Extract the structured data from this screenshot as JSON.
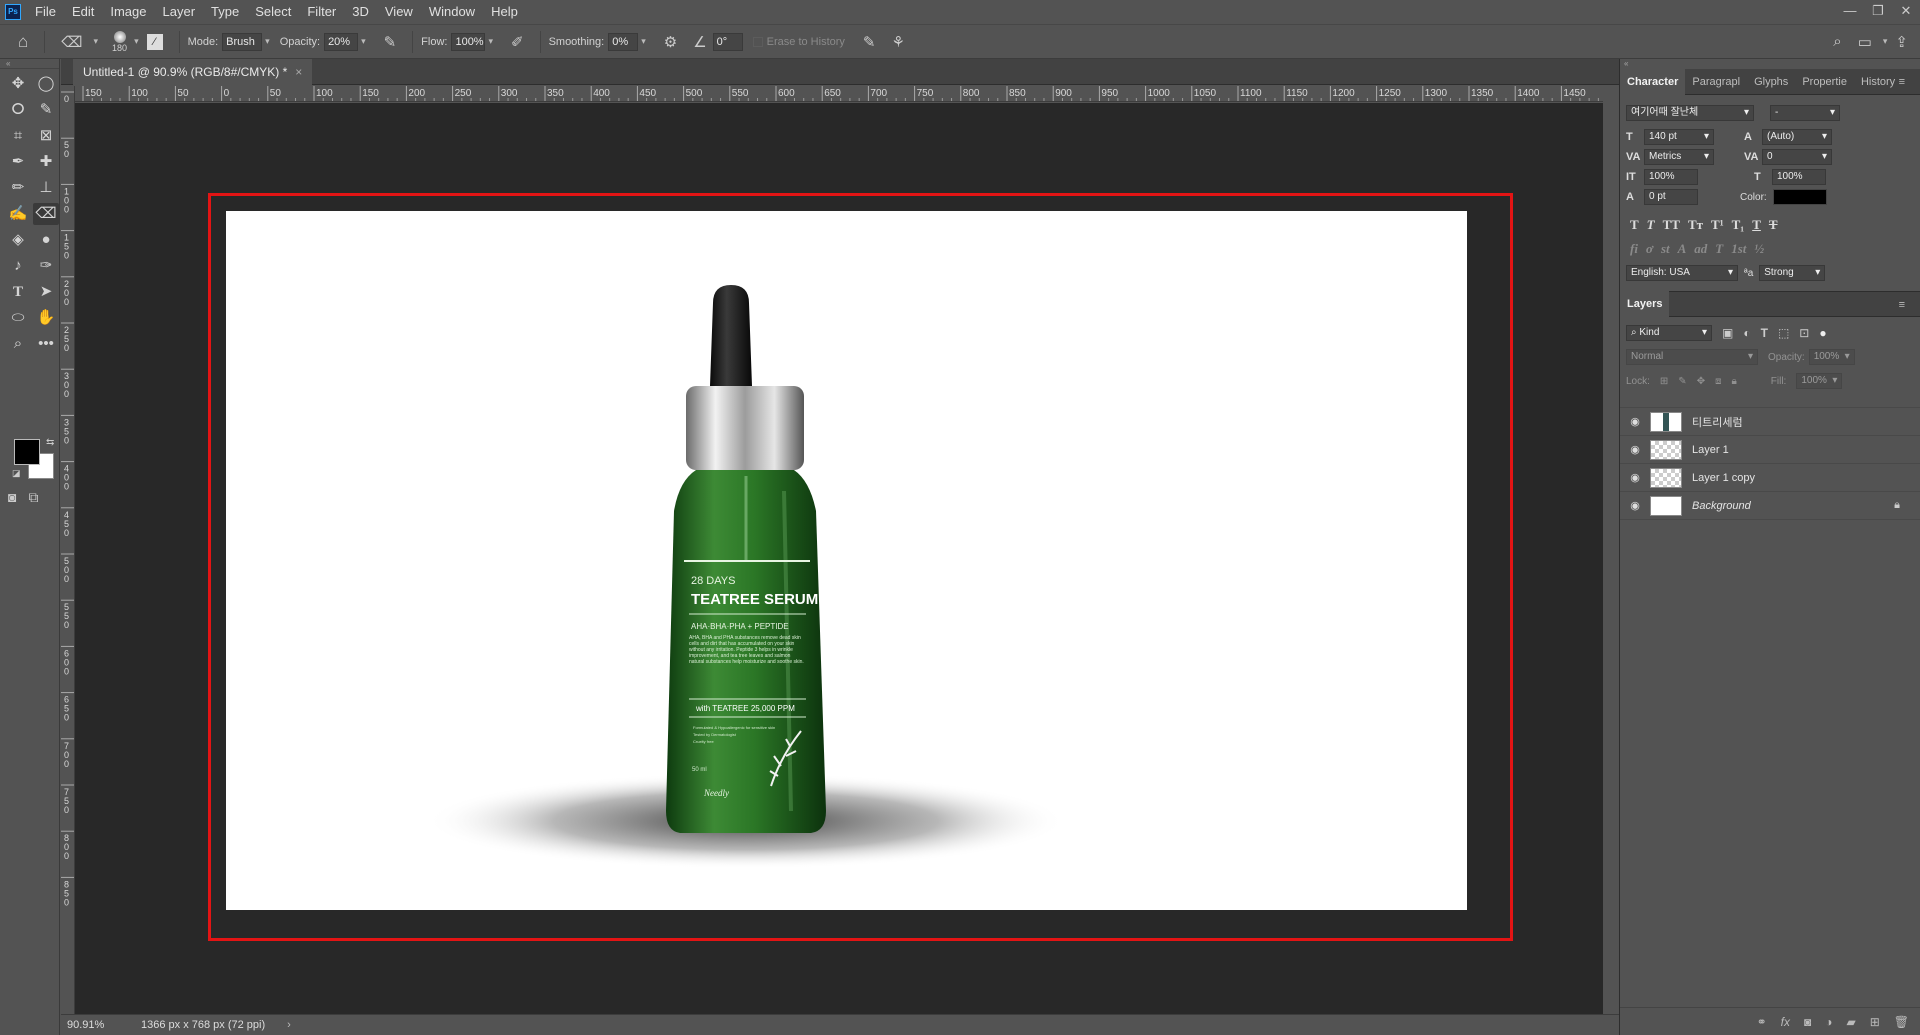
{
  "menubar": {
    "logo": "Ps",
    "items": [
      "File",
      "Edit",
      "Image",
      "Layer",
      "Type",
      "Select",
      "Filter",
      "3D",
      "View",
      "Window",
      "Help"
    ],
    "window_controls": [
      "—",
      "❐",
      "✕"
    ]
  },
  "options": {
    "brush_size": "180",
    "mode_label": "Mode:",
    "mode_value": "Brush",
    "opacity_label": "Opacity:",
    "opacity_value": "20%",
    "flow_label": "Flow:",
    "flow_value": "100%",
    "smoothing_label": "Smoothing:",
    "smoothing_value": "0%",
    "angle_value": "0°",
    "erase_history": "Erase to History"
  },
  "document": {
    "tab_title": "Untitled-1 @ 90.9% (RGB/8#/CMYK) *",
    "close": "×",
    "zoom": "90.91%",
    "info": "1366 px x 768 px (72 ppi)",
    "status_arrow": "›"
  },
  "rulers": {
    "top_ticks": [
      "150",
      "100",
      "50",
      "0",
      "50",
      "100",
      "150",
      "200",
      "250",
      "300",
      "350",
      "400",
      "450",
      "500",
      "550",
      "600",
      "650",
      "700",
      "750",
      "800",
      "850",
      "900",
      "950",
      "1000",
      "1050",
      "1100",
      "1150",
      "1200",
      "1250",
      "1300",
      "1350",
      "1400",
      "1450",
      "15"
    ],
    "left_ticks": [
      "0",
      "5\n0",
      "1\n0\n0",
      "1\n5\n0",
      "2\n0\n0",
      "2\n5\n0",
      "3\n0\n0",
      "3\n5\n0",
      "4\n0\n0",
      "4\n5\n0",
      "5\n0\n0",
      "5\n5\n0",
      "6\n0\n0",
      "6\n5\n0",
      "7\n0\n0",
      "7\n5\n0",
      "8\n0\n0",
      "8\n5\n0"
    ]
  },
  "product": {
    "line1": "28 DAYS",
    "line2": "TEATREE SERUM",
    "line3": "AHA·BHA·PHA + PEPTIDE",
    "body": "AHA, BHA and PHA substances remove dead skin cells and dirt that has accumulated on your skin without any irritation. Peptide 3 helps in wrinkle improvement, and tea tree leaves and salmon natural substances help moisturize and soothe skin.",
    "with": "with TEATREE 25,000 PPM",
    "bullets": [
      "Formulated & Hypoallergenic for sensitive skin",
      "Tested by Dermatologist",
      "Cruelty free"
    ],
    "volume": "50 ml",
    "brand": "Needly"
  },
  "character_panel": {
    "tabs": [
      "Character",
      "Paragrapl",
      "Glyphs",
      "Propertie",
      "History"
    ],
    "font_family": "여기어때 잘난체",
    "font_style": "-",
    "size": "140 pt",
    "leading": "(Auto)",
    "kerning": "Metrics",
    "tracking": "0",
    "vscale": "100%",
    "hscale": "100%",
    "baseline": "0 pt",
    "color_label": "Color:",
    "style_buttons": [
      "T",
      "T",
      "TT",
      "Tт",
      "T¹",
      "T₁",
      "T",
      "T"
    ],
    "opentype_buttons": [
      "fi",
      "ơ",
      "st",
      "A",
      "ad",
      "T",
      "1st",
      "½"
    ],
    "language": "English: USA",
    "aa_label": "ªa",
    "antialias": "Strong"
  },
  "layers_panel": {
    "title": "Layers",
    "kind": "Kind",
    "blend": "Normal",
    "opacity_label": "Opacity:",
    "opacity": "100%",
    "lock_label": "Lock:",
    "fill_label": "Fill:",
    "fill": "100%",
    "layers": [
      {
        "name": "티트리세럼"
      },
      {
        "name": "Layer 1"
      },
      {
        "name": "Layer 1 copy"
      },
      {
        "name": "Background"
      }
    ]
  },
  "colors": {
    "highlight": "#e31414",
    "bottle_green": "#2f7a2a",
    "foreground": "#000000",
    "background": "#ffffff"
  }
}
